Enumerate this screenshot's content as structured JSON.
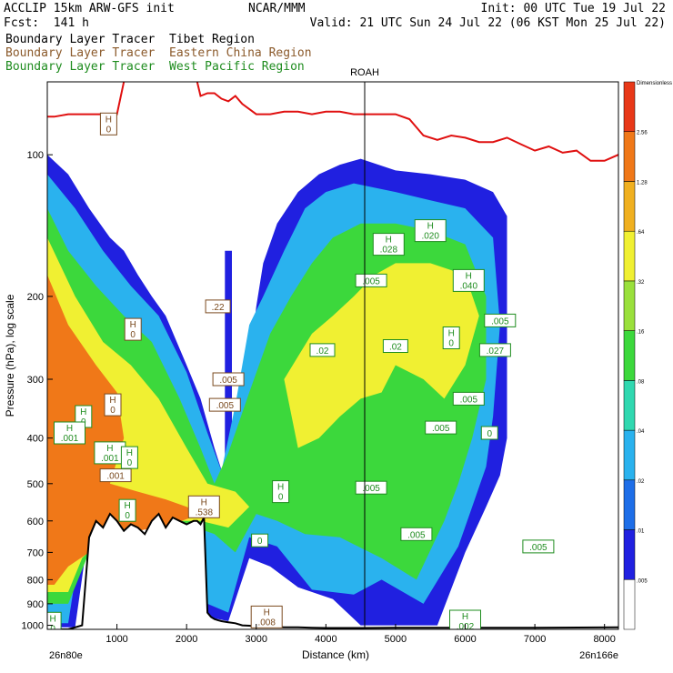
{
  "header": {
    "left_line1": "ACCLIP 15km ARW-GFS init",
    "left_line2": "Fcst:  141 h",
    "center_line1": "NCAR/MMM",
    "init": "Init: 00 UTC Tue 19 Jul 22",
    "valid": "Valid: 21 UTC Sun 24 Jul 22 (06 KST Mon 25 Jul 22)"
  },
  "legend": {
    "tibet": "Boundary Layer Tracer  Tibet Region",
    "china": "Boundary Layer Tracer  Eastern China Region",
    "pacific": "Boundary Layer Tracer  West Pacific Region"
  },
  "colors": {
    "tibet_fill": [
      "#2020e0",
      "#1e6ee8",
      "#2ab2ee",
      "#30d8b0",
      "#3cd83c",
      "#9ae03c",
      "#f0f032",
      "#f0b020",
      "#f07818",
      "#e83818"
    ],
    "china_contour": "#7a4a1e",
    "pacific_contour": "#1e8c1e",
    "tropopause": "#e01010",
    "terrain": "#000000"
  },
  "chart_data": {
    "type": "heatmap",
    "subtype": "vertical cross-section",
    "xlabel": "Distance (km)",
    "ylabel": "Pressure (hPa), log scale",
    "x_ticks": [
      "1000",
      "2000",
      "3000",
      "4000",
      "5000",
      "6000",
      "7000",
      "8000"
    ],
    "y_ticks": [
      "100",
      "200",
      "300",
      "400",
      "500",
      "600",
      "700",
      "800",
      "900",
      "1000"
    ],
    "x_endpoints": {
      "left": "26n80e",
      "right": "26n166e"
    },
    "section_marker": "ROAH",
    "xlim": [
      0,
      8200
    ],
    "ylim_hpa": [
      1020,
      70
    ],
    "log_scale_y": true,
    "colorbar_levels": [
      ".005",
      ".01",
      ".02",
      ".04",
      ".08",
      ".16",
      ".32",
      ".64",
      "1.28",
      "2.56"
    ],
    "colorbar_top_label": "Dimensionless",
    "tropopause": {
      "x": [
        0,
        100,
        300,
        450,
        600,
        680,
        720,
        900,
        1000,
        1100,
        1200,
        1300,
        1380,
        1500,
        1600,
        1700,
        1800,
        1900,
        2000,
        2100,
        2200,
        2300,
        2400,
        2500,
        2600,
        2700,
        2800,
        3000,
        3200,
        3400,
        3600,
        3800,
        4000,
        4200,
        4400,
        4600,
        4800,
        5000,
        5200,
        5400,
        5600,
        5800,
        6000,
        6200,
        6400,
        6600,
        6800,
        7000,
        7200,
        7400,
        7600,
        7800,
        8000,
        8200
      ],
      "p": [
        83,
        83,
        82,
        82,
        82,
        82,
        82,
        82,
        82,
        70,
        55,
        58,
        55,
        52,
        53,
        54,
        58,
        60,
        62,
        65,
        75,
        74,
        74,
        76,
        77,
        75,
        78,
        82,
        82,
        81,
        81,
        82,
        81,
        81,
        82,
        82,
        82,
        82,
        84,
        91,
        93,
        91,
        92,
        94,
        94,
        92,
        95,
        98,
        96,
        99,
        98,
        103,
        103,
        100
      ]
    },
    "terrain": {
      "x": [
        0,
        300,
        500,
        600,
        700,
        800,
        900,
        1000,
        1100,
        1200,
        1300,
        1400,
        1500,
        1600,
        1700,
        1800,
        1900,
        2000,
        2100,
        2150,
        2200,
        2250,
        2300,
        2350,
        2400,
        2450,
        2500,
        2600,
        2700,
        2800,
        2900,
        3000,
        3200,
        3400,
        3600,
        3800,
        4000,
        4500,
        5000,
        6000,
        7000,
        8200
      ],
      "p": [
        1020,
        1020,
        1000,
        650,
        600,
        620,
        580,
        600,
        630,
        610,
        620,
        640,
        600,
        580,
        620,
        590,
        600,
        610,
        600,
        600,
        610,
        590,
        940,
        960,
        970,
        975,
        980,
        985,
        990,
        1000,
        1002,
        1005,
        1008,
        1010,
        1010,
        1012,
        1013,
        1013,
        1012,
        1012,
        1012,
        1010
      ]
    },
    "tibet_tracer": [
      {
        "level": ".01",
        "polys": [
          [
            [
              0,
              100
            ],
            [
              300,
              110
            ],
            [
              600,
              130
            ],
            [
              900,
              150
            ],
            [
              1100,
              160
            ],
            [
              1300,
              180
            ],
            [
              1500,
              200
            ],
            [
              1700,
              220
            ],
            [
              2000,
              280
            ],
            [
              2200,
              330
            ],
            [
              2400,
              420
            ],
            [
              2600,
              520
            ],
            [
              2800,
              380
            ],
            [
              3000,
              210
            ],
            [
              3100,
              170
            ],
            [
              3300,
              140
            ],
            [
              3600,
              120
            ],
            [
              3900,
              110
            ],
            [
              4200,
              105
            ],
            [
              4500,
              102
            ],
            [
              5000,
              108
            ],
            [
              5500,
              110
            ],
            [
              6000,
              113
            ],
            [
              6400,
              120
            ],
            [
              6600,
              135
            ],
            [
              6600,
              250
            ],
            [
              6600,
              400
            ],
            [
              6500,
              480
            ],
            [
              6300,
              560
            ],
            [
              6000,
              700
            ],
            [
              5600,
              1000
            ],
            [
              5000,
              1000
            ],
            [
              4500,
              1000
            ],
            [
              4100,
              880
            ],
            [
              3600,
              830
            ],
            [
              3200,
              750
            ],
            [
              2900,
              720
            ],
            [
              2600,
              980
            ],
            [
              2300,
              960
            ],
            [
              2250,
              600
            ],
            [
              1900,
              560
            ],
            [
              1500,
              550
            ],
            [
              1000,
              560
            ],
            [
              600,
              620
            ],
            [
              400,
              1010
            ],
            [
              0,
              1010
            ]
          ],
          [
            [
              2550,
              160
            ],
            [
              2650,
              160
            ],
            [
              2650,
              500
            ],
            [
              2550,
              500
            ]
          ]
        ]
      },
      {
        "level": ".04",
        "polys": [
          [
            [
              0,
              110
            ],
            [
              400,
              130
            ],
            [
              800,
              160
            ],
            [
              1200,
              190
            ],
            [
              1600,
              220
            ],
            [
              2000,
              290
            ],
            [
              2300,
              390
            ],
            [
              2500,
              470
            ],
            [
              2700,
              340
            ],
            [
              2900,
              230
            ],
            [
              3100,
              200
            ],
            [
              3400,
              160
            ],
            [
              3700,
              130
            ],
            [
              4000,
              120
            ],
            [
              4400,
              115
            ],
            [
              5000,
              120
            ],
            [
              5500,
              125
            ],
            [
              6000,
              130
            ],
            [
              6400,
              150
            ],
            [
              6500,
              230
            ],
            [
              6400,
              360
            ],
            [
              6300,
              460
            ],
            [
              6100,
              560
            ],
            [
              5900,
              680
            ],
            [
              5400,
              900
            ],
            [
              4800,
              800
            ],
            [
              4400,
              860
            ],
            [
              3800,
              840
            ],
            [
              3300,
              680
            ],
            [
              2900,
              650
            ],
            [
              2600,
              940
            ],
            [
              2300,
              900
            ],
            [
              2250,
              620
            ],
            [
              1900,
              580
            ],
            [
              1400,
              570
            ],
            [
              900,
              580
            ],
            [
              500,
              640
            ],
            [
              300,
              990
            ],
            [
              0,
              990
            ]
          ]
        ]
      },
      {
        "level": ".16",
        "polys": [
          [
            [
              0,
              130
            ],
            [
              300,
              160
            ],
            [
              700,
              190
            ],
            [
              1100,
              220
            ],
            [
              1500,
              250
            ],
            [
              1900,
              330
            ],
            [
              2200,
              420
            ],
            [
              2400,
              500
            ],
            [
              2600,
              430
            ],
            [
              2900,
              320
            ],
            [
              3200,
              240
            ],
            [
              3500,
              200
            ],
            [
              3800,
              170
            ],
            [
              4100,
              150
            ],
            [
              4500,
              140
            ],
            [
              5000,
              140
            ],
            [
              5500,
              145
            ],
            [
              6000,
              155
            ],
            [
              6300,
              200
            ],
            [
              6300,
              300
            ],
            [
              6100,
              400
            ],
            [
              5900,
              500
            ],
            [
              5700,
              600
            ],
            [
              5300,
              800
            ],
            [
              4800,
              720
            ],
            [
              4200,
              650
            ],
            [
              3700,
              640
            ],
            [
              3300,
              600
            ],
            [
              3000,
              580
            ],
            [
              2700,
              700
            ],
            [
              2400,
              640
            ],
            [
              2000,
              610
            ],
            [
              1500,
              600
            ],
            [
              1000,
              620
            ],
            [
              600,
              700
            ],
            [
              300,
              900
            ],
            [
              0,
              900
            ]
          ]
        ]
      },
      {
        "level": ".32",
        "polys": [
          [
            [
              0,
              150
            ],
            [
              400,
              200
            ],
            [
              800,
              250
            ],
            [
              1200,
              280
            ],
            [
              1600,
              330
            ],
            [
              2000,
              420
            ],
            [
              2300,
              500
            ],
            [
              2700,
              520
            ],
            [
              2900,
              560
            ],
            [
              2600,
              620
            ],
            [
              2200,
              600
            ],
            [
              1700,
              600
            ],
            [
              1200,
              620
            ],
            [
              800,
              650
            ],
            [
              500,
              720
            ],
            [
              300,
              850
            ],
            [
              0,
              850
            ]
          ],
          [
            [
              3400,
              300
            ],
            [
              3800,
              240
            ],
            [
              4100,
              220
            ],
            [
              4400,
              200
            ],
            [
              4700,
              180
            ],
            [
              5000,
              170
            ],
            [
              5500,
              170
            ],
            [
              6000,
              180
            ],
            [
              6200,
              220
            ],
            [
              6000,
              280
            ],
            [
              5700,
              330
            ],
            [
              5400,
              300
            ],
            [
              5000,
              280
            ],
            [
              4800,
              320
            ],
            [
              4500,
              330
            ],
            [
              4200,
              360
            ],
            [
              3900,
              400
            ],
            [
              3600,
              420
            ]
          ]
        ]
      },
      {
        "level": ".64",
        "polys": [
          [
            [
              0,
              180
            ],
            [
              300,
              230
            ],
            [
              700,
              280
            ],
            [
              1000,
              320
            ],
            [
              1100,
              400
            ],
            [
              900,
              500
            ],
            [
              1300,
              520
            ],
            [
              1700,
              540
            ],
            [
              2000,
              560
            ],
            [
              2200,
              580
            ],
            [
              1800,
              610
            ],
            [
              1300,
              630
            ],
            [
              900,
              660
            ],
            [
              600,
              700
            ],
            [
              300,
              750
            ],
            [
              100,
              820
            ],
            [
              0,
              820
            ]
          ]
        ]
      }
    ],
    "china_labels": [
      {
        "text": "H",
        "sub": "0",
        "x": 880,
        "p": 86
      },
      {
        "text": "",
        "sub": ".22",
        "x": 2450,
        "p": 210
      },
      {
        "text": "H",
        "sub": "0",
        "x": 1230,
        "p": 235
      },
      {
        "text": "",
        "sub": ".005",
        "x": 2600,
        "p": 300
      },
      {
        "text": "",
        "sub": ".005",
        "x": 2550,
        "p": 340
      },
      {
        "text": "H",
        "sub": "0",
        "x": 940,
        "p": 340
      },
      {
        "text": "",
        "sub": ".001",
        "x": 980,
        "p": 480
      },
      {
        "text": "H",
        "sub": ".538",
        "x": 2250,
        "p": 560
      },
      {
        "text": "H",
        "sub": ".008",
        "x": 3150,
        "p": 960
      }
    ],
    "pacific_labels": [
      {
        "text": "H",
        "sub": ".028",
        "x": 4900,
        "p": 155
      },
      {
        "text": "H",
        "sub": ".020",
        "x": 5500,
        "p": 145
      },
      {
        "text": "",
        "sub": ".005",
        "x": 4650,
        "p": 185
      },
      {
        "text": "H",
        "sub": ".040",
        "x": 6050,
        "p": 185
      },
      {
        "text": "",
        "sub": ".005",
        "x": 6500,
        "p": 225
      },
      {
        "text": "",
        "sub": ".02",
        "x": 3950,
        "p": 260
      },
      {
        "text": "",
        "sub": ".02",
        "x": 5000,
        "p": 255
      },
      {
        "text": "H",
        "sub": "0",
        "x": 5800,
        "p": 245
      },
      {
        "text": "",
        "sub": ".027",
        "x": 6430,
        "p": 260
      },
      {
        "text": "",
        "sub": ".005",
        "x": 6050,
        "p": 330
      },
      {
        "text": "",
        "sub": ".005",
        "x": 5650,
        "p": 380
      },
      {
        "text": "",
        "sub": "0",
        "x": 6350,
        "p": 390
      },
      {
        "text": "H",
        "sub": "0",
        "x": 520,
        "p": 360
      },
      {
        "text": "H",
        "sub": ".001",
        "x": 320,
        "p": 390
      },
      {
        "text": "H",
        "sub": ".001",
        "x": 900,
        "p": 430
      },
      {
        "text": "H",
        "sub": "0",
        "x": 1180,
        "p": 440
      },
      {
        "text": "",
        "sub": ".005",
        "x": 4650,
        "p": 510
      },
      {
        "text": "H",
        "sub": "0",
        "x": 3350,
        "p": 520
      },
      {
        "text": "H",
        "sub": "0",
        "x": 1150,
        "p": 570
      },
      {
        "text": "",
        "sub": "0",
        "x": 3050,
        "p": 660
      },
      {
        "text": "",
        "sub": ".005",
        "x": 5300,
        "p": 640
      },
      {
        "text": "",
        "sub": ".005",
        "x": 7050,
        "p": 680
      },
      {
        "text": "H",
        "sub": ".002",
        "x": 6000,
        "p": 980
      },
      {
        "text": "H",
        "sub": "0",
        "x": 80,
        "p": 990
      }
    ]
  }
}
